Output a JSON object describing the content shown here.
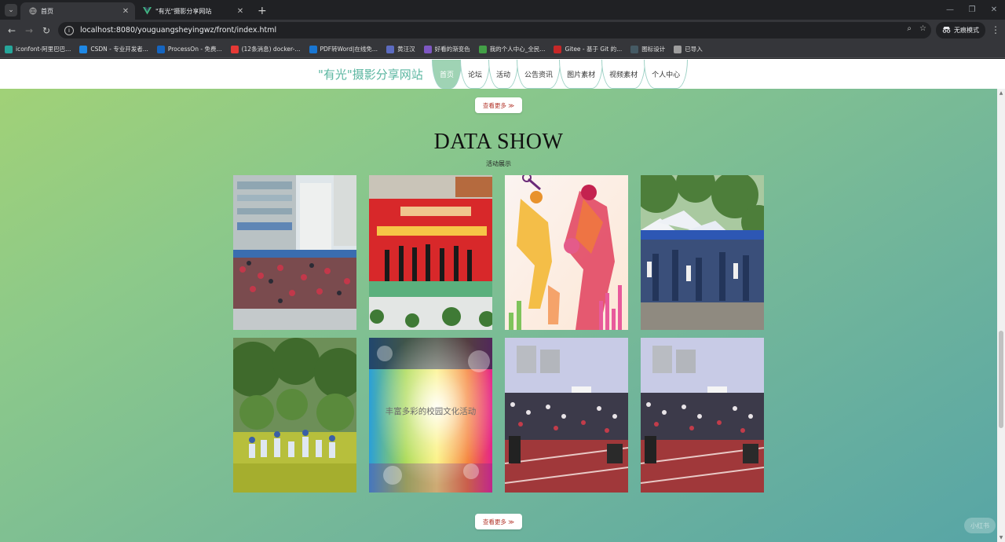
{
  "browser": {
    "tabs": [
      {
        "title": "首页",
        "active": true
      },
      {
        "title": "\"有光\"摄影分享网站",
        "active": false
      }
    ],
    "url": "localhost:8080/youguangsheyingwz/front/index.html",
    "incognito_label": "无痕模式",
    "bookmarks": [
      {
        "label": "iconfont-阿里巴巴...",
        "icon": "iconfont-icon",
        "color": "#26a69a"
      },
      {
        "label": "CSDN - 专业开发者...",
        "icon": "csdn-icon",
        "color": "#1e88e5"
      },
      {
        "label": "ProcessOn - 免费...",
        "icon": "processon-icon",
        "color": "#1565c0"
      },
      {
        "label": "(12条消息) docker-...",
        "icon": "csdn-c-icon",
        "color": "#e53935"
      },
      {
        "label": "PDF转Word|在线免...",
        "icon": "pdf-icon",
        "color": "#1976d2"
      },
      {
        "label": "黄汪汉",
        "icon": "bookmark-icon",
        "color": "#5c6bc0"
      },
      {
        "label": "好看的渐变色",
        "icon": "gradient-icon",
        "color": "#7e57c2"
      },
      {
        "label": "我的个人中心_全民...",
        "icon": "profile-icon",
        "color": "#43a047"
      },
      {
        "label": "Gitee - 基于 Git 的...",
        "icon": "gitee-icon",
        "color": "#c62828"
      },
      {
        "label": "图标设计",
        "icon": "design-icon",
        "color": "#455a64"
      },
      {
        "label": "已导入",
        "icon": "folder-icon",
        "color": "#9e9e9e"
      }
    ]
  },
  "site": {
    "brand": "\"有光\"摄影分享网站",
    "nav": [
      {
        "label": "首页",
        "active": true
      },
      {
        "label": "论坛",
        "active": false
      },
      {
        "label": "活动",
        "active": false
      },
      {
        "label": "公告资讯",
        "active": false
      },
      {
        "label": "图片素材",
        "active": false
      },
      {
        "label": "视频素材",
        "active": false
      },
      {
        "label": "个人中心",
        "active": false
      }
    ],
    "more_top": "查看更多 ≫",
    "section_title": "DATA SHOW",
    "section_subtitle": "活动展示",
    "more_bottom": "查看更多 ≫",
    "cards": [
      {
        "name": "activity-photo-1",
        "caption": ""
      },
      {
        "name": "activity-photo-2",
        "caption": ""
      },
      {
        "name": "activity-photo-3",
        "caption": ""
      },
      {
        "name": "activity-photo-4",
        "caption": ""
      },
      {
        "name": "activity-photo-5",
        "caption": ""
      },
      {
        "name": "activity-photo-6",
        "caption": "丰富多彩的校园文化活动"
      },
      {
        "name": "activity-photo-7",
        "caption": ""
      },
      {
        "name": "activity-photo-8",
        "caption": ""
      }
    ],
    "watermark": "小红书"
  }
}
